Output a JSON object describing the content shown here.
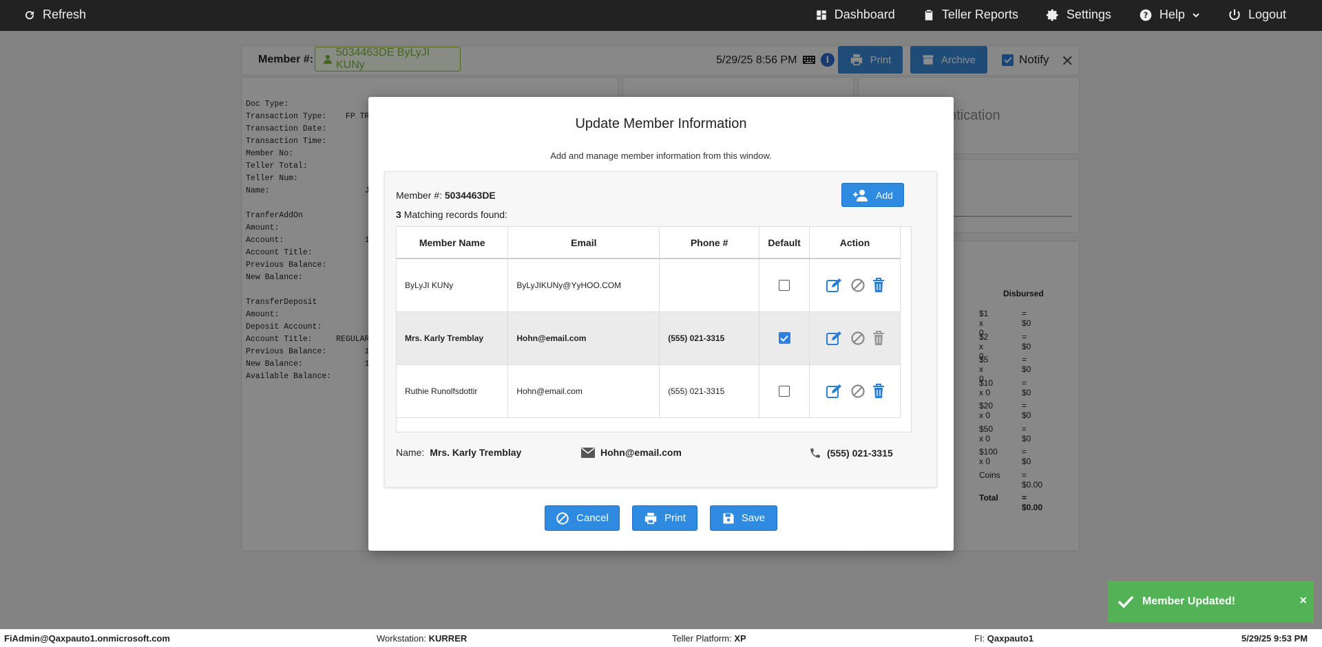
{
  "topbar": {
    "refresh": "Refresh",
    "dashboard": "Dashboard",
    "teller_reports": "Teller Reports",
    "settings": "Settings",
    "help": "Help",
    "logout": "Logout"
  },
  "member_header": {
    "label": "Member #:",
    "member_chip": "5034463DE ByLyJI KUNy",
    "datetime": "5/29/25 8:56 PM",
    "print": "Print",
    "archive": "Archive",
    "notify": "Notify"
  },
  "receipt_lines": "Doc Type:\nTransaction Type:    FP TRA\nTransaction Date:\nTransaction Time:\nMember No:                5\nTeller Total:\nTeller Num:\nName:                    Ja\n\nTranferAddOn\nAmount:\nAccount:                 1\nAccount Title:\nPrevious Balance:\nNew Balance:\n\nTransferDeposit\nAmount:\nDeposit Account:\nAccount Title:     REGULAR\nPrevious Balance:        1\nNew Balance:             1\nAvailable Balance:",
  "auth_panel_text": "entication",
  "disbursed": {
    "title": "Disbursed",
    "rows": [
      {
        "denom": "$1 x 0",
        "amount": "= $0"
      },
      {
        "denom": "$2 x 0",
        "amount": "= $0"
      },
      {
        "denom": "$5 x 0",
        "amount": "= $0"
      },
      {
        "denom": "$10 x 0",
        "amount": "= $0"
      },
      {
        "denom": "$20 x 0",
        "amount": "= $0"
      },
      {
        "denom": "$50 x 0",
        "amount": "= $0"
      },
      {
        "denom": "$100 x 0",
        "amount": "= $0"
      },
      {
        "denom": "Coins",
        "amount": "= $0.00"
      },
      {
        "denom": "Total",
        "amount": "= $0.00"
      }
    ]
  },
  "modal": {
    "title": "Update Member Information",
    "subtitle": "Add and manage member information from this window.",
    "member_label": "Member #:",
    "member_number": "5034463DE",
    "match_count": "3",
    "match_text": "Matching records found:",
    "add_label": "Add",
    "columns": [
      "Member Name",
      "Email",
      "Phone #",
      "Default",
      "Action"
    ],
    "rows": [
      {
        "name": "ByLyJI KUNy",
        "email": "ByLyJIKUNy@YyHOO.COM",
        "phone": "",
        "default": false,
        "selected": false
      },
      {
        "name": "Mrs. Karly Tremblay",
        "email": "Hohn@email.com",
        "phone": "(555) 021-3315",
        "default": true,
        "selected": true
      },
      {
        "name": "Ruthie Runolfsdottir",
        "email": "Hohn@email.com",
        "phone": "(555) 021-3315",
        "default": false,
        "selected": false
      }
    ],
    "summary": {
      "name_label": "Name:",
      "name": "Mrs. Karly Tremblay",
      "email": "Hohn@email.com",
      "phone": "(555) 021-3315"
    },
    "cancel": "Cancel",
    "print": "Print",
    "save": "Save"
  },
  "toast": {
    "message": "Member Updated!",
    "close": "×"
  },
  "status_bar": {
    "user": "FiAdmin@Qaxpauto1.onmicrosoft.com",
    "workstation_label": "Workstation:",
    "workstation": "KURRER",
    "platform_label": "Teller Platform:",
    "platform": "XP",
    "fi_label": "FI:",
    "fi": "Qaxpauto1",
    "datetime": "5/29/25 9:53 PM"
  },
  "colors": {
    "topbar": "#222222",
    "primary_button": "#2f8be0",
    "toast": "#52b256",
    "member_chip": "#7ab83a"
  }
}
